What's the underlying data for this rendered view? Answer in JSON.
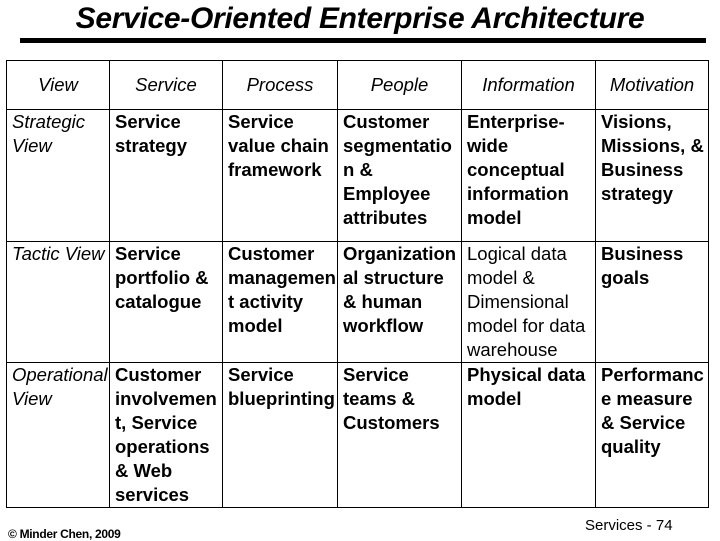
{
  "slide": {
    "title": "Service-Oriented Enterprise Architecture",
    "footer_left": "© Minder Chen, 2009",
    "footer_right": "Services - 74"
  },
  "table": {
    "columns": [
      "View",
      "Service",
      "Process",
      "People",
      "Information",
      "Motivation"
    ],
    "rows": [
      {
        "view": "Strategic View",
        "cells": [
          "Service strategy",
          "Service value chain framework",
          "Customer segmentation & Employee attributes",
          "Enterprise-wide conceptual information model",
          "Visions, Missions, & Business strategy"
        ]
      },
      {
        "view": "Tactic View",
        "cells": [
          "Service portfolio & catalogue",
          "Customer management activity model",
          "Organizational structure & human workflow",
          "Logical data model & Dimensional model for data warehouse",
          "Business goals"
        ]
      },
      {
        "view": "Operational View",
        "cells": [
          "Customer involvement, Service operations & Web services",
          "Service blueprinting",
          "Service teams & Customers",
          "Physical data model",
          "Performance measure & Service quality"
        ]
      }
    ]
  }
}
